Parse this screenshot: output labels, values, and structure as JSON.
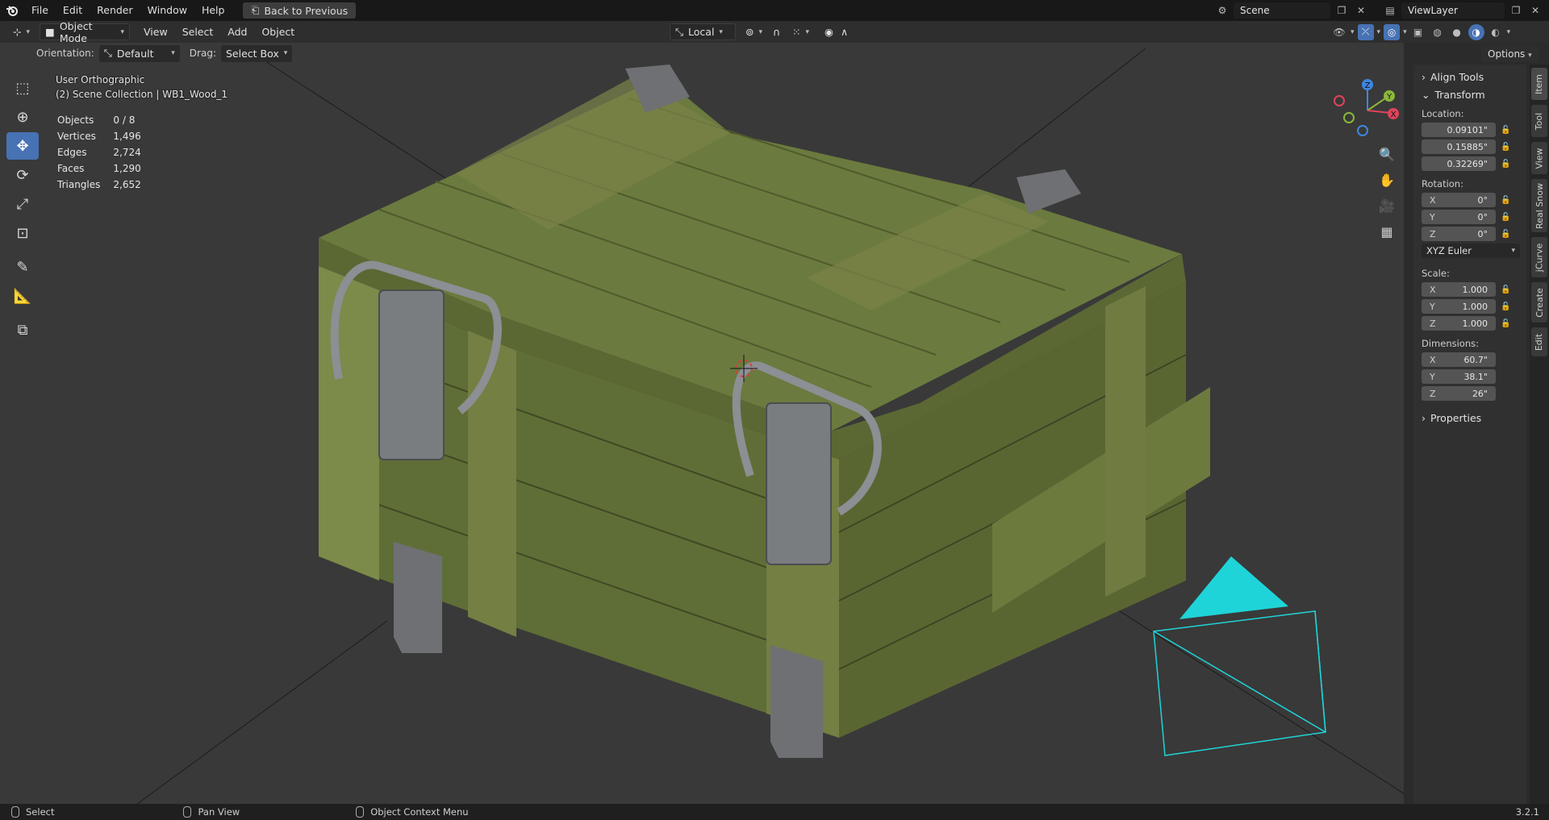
{
  "topbar": {
    "menus": [
      "File",
      "Edit",
      "Render",
      "Window",
      "Help"
    ],
    "back_button": "Back to Previous",
    "scene_name": "Scene",
    "view_layer": "ViewLayer"
  },
  "header": {
    "mode": "Object Mode",
    "menus": [
      "View",
      "Select",
      "Add",
      "Object"
    ],
    "transform_pivot": "Local",
    "orientation_label": "Orientation:",
    "orientation_value": "Default",
    "drag_label": "Drag:",
    "drag_value": "Select Box",
    "options_label": "Options"
  },
  "viewport": {
    "view_name": "User Orthographic",
    "collection": "(2) Scene Collection | WB1_Wood_1",
    "stats": [
      {
        "label": "Objects",
        "value": "0 / 8"
      },
      {
        "label": "Vertices",
        "value": "1,496"
      },
      {
        "label": "Edges",
        "value": "2,724"
      },
      {
        "label": "Faces",
        "value": "1,290"
      },
      {
        "label": "Triangles",
        "value": "2,652"
      }
    ],
    "gizmo_axes": {
      "x": "X",
      "y": "Y",
      "z": "Z"
    }
  },
  "npanel": {
    "align_tools": "Align Tools",
    "transform": "Transform",
    "location_label": "Location:",
    "location": [
      "0.09101\"",
      "0.15885\"",
      "0.32269\""
    ],
    "rotation_label": "Rotation:",
    "rotation": [
      {
        "axis": "X",
        "value": "0°"
      },
      {
        "axis": "Y",
        "value": "0°"
      },
      {
        "axis": "Z",
        "value": "0°"
      }
    ],
    "rotation_mode": "XYZ Euler",
    "scale_label": "Scale:",
    "scale": [
      {
        "axis": "X",
        "value": "1.000"
      },
      {
        "axis": "Y",
        "value": "1.000"
      },
      {
        "axis": "Z",
        "value": "1.000"
      }
    ],
    "dimensions_label": "Dimensions:",
    "dimensions": [
      {
        "axis": "X",
        "value": "60.7\""
      },
      {
        "axis": "Y",
        "value": "38.1\""
      },
      {
        "axis": "Z",
        "value": "26\""
      }
    ],
    "properties": "Properties"
  },
  "sidetabs": [
    "Item",
    "Tool",
    "View",
    "Real Snow",
    "jCurve",
    "Create",
    "Edit"
  ],
  "statusbar": {
    "select": "Select",
    "pan_view": "Pan View",
    "context_menu": "Object Context Menu",
    "version": "3.2.1"
  },
  "colors": {
    "accent": "#4772b3",
    "crate_green": "#6a7a3a",
    "camera_cyan": "#1fd4d8",
    "axis_x": "#e0435a",
    "axis_y": "#8ab83a",
    "axis_z": "#3e86e0"
  }
}
